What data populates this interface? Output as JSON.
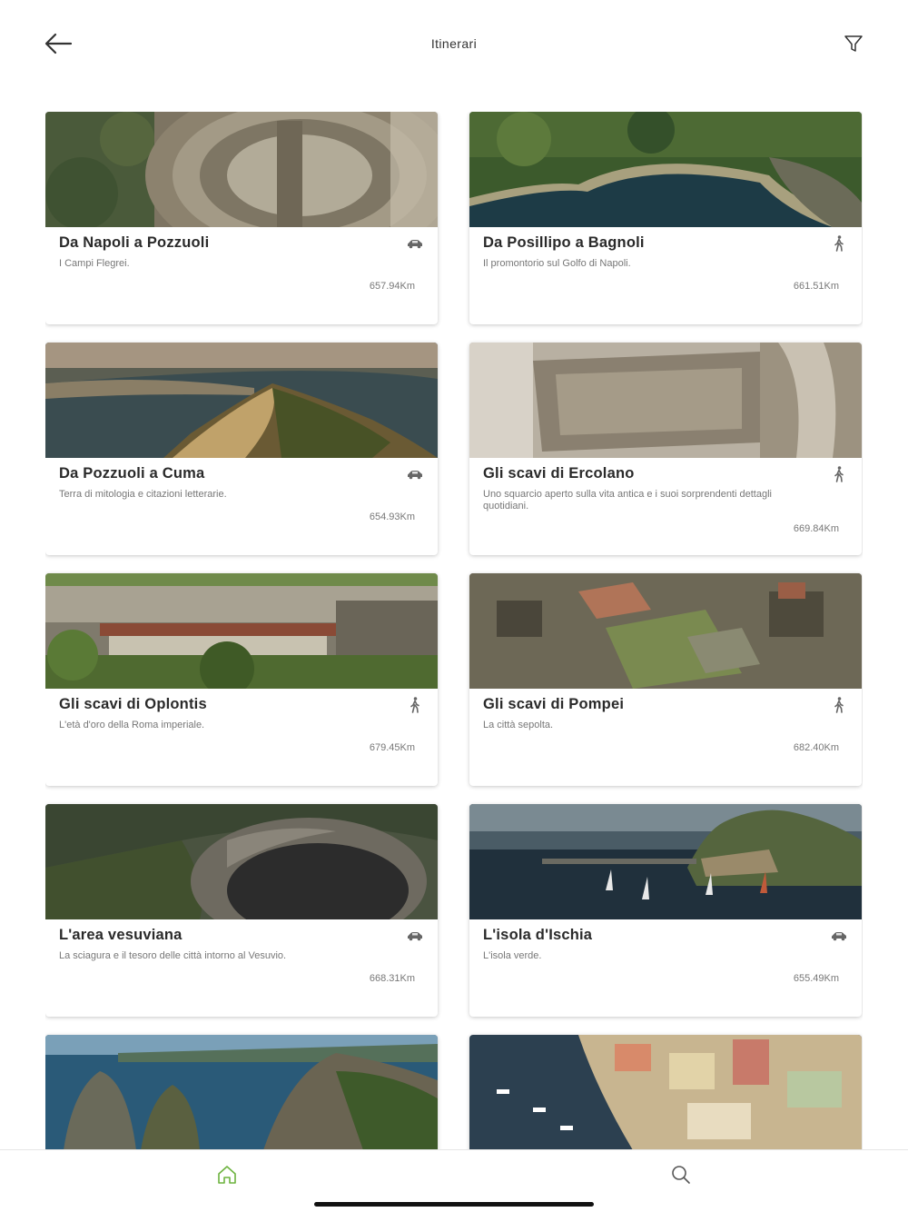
{
  "header": {
    "title": "Itinerari",
    "back_icon": "arrow-left-icon",
    "filter_icon": "filter-funnel-icon"
  },
  "cards": [
    {
      "title": "Da Napoli a Pozzuoli",
      "description": "I Campi Flegrei.",
      "distance": "657.94Km",
      "mode": "car"
    },
    {
      "title": "Da Posillipo a Bagnoli",
      "description": "Il promontorio sul Golfo di Napoli.",
      "distance": "661.51Km",
      "mode": "walk"
    },
    {
      "title": "Da Pozzuoli a Cuma",
      "description": "Terra di mitologia e citazioni letterarie.",
      "distance": "654.93Km",
      "mode": "car"
    },
    {
      "title": "Gli scavi di Ercolano",
      "description": "Uno squarcio aperto sulla vita antica e i suoi sorprendenti dettagli quotidiani.",
      "distance": "669.84Km",
      "mode": "walk"
    },
    {
      "title": "Gli scavi di Oplontis",
      "description": "L'età d'oro della Roma imperiale.",
      "distance": "679.45Km",
      "mode": "walk"
    },
    {
      "title": "Gli scavi di Pompei",
      "description": "La città sepolta.",
      "distance": "682.40Km",
      "mode": "walk"
    },
    {
      "title": "L'area vesuviana",
      "description": "La sciagura e il tesoro delle città intorno al Vesuvio.",
      "distance": "668.31Km",
      "mode": "car"
    },
    {
      "title": "L'isola d'Ischia",
      "description": "L'isola verde.",
      "distance": "655.49Km",
      "mode": "car"
    },
    {
      "title": "",
      "description": "",
      "distance": "",
      "mode": ""
    },
    {
      "title": "",
      "description": "",
      "distance": "",
      "mode": ""
    }
  ],
  "tabbar": {
    "items": [
      {
        "icon": "home-icon",
        "active": true
      },
      {
        "icon": "search-icon",
        "active": false
      }
    ]
  },
  "colors": {
    "accent": "#6db33f",
    "icon_gray": "#555555"
  }
}
